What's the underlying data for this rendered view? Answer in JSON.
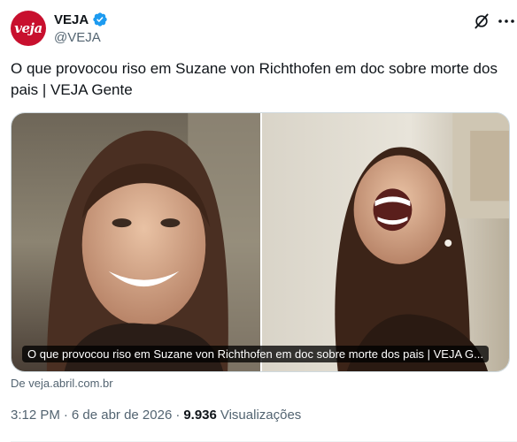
{
  "author": {
    "avatar_text": "veja",
    "display_name": "VEJA",
    "handle": "@VEJA",
    "verified": true,
    "brand_color": "#c8102e",
    "verified_color": "#1d9bf0"
  },
  "tweet": {
    "text": "O que provocou riso em Suzane von Richthofen em doc sobre morte dos pais | VEJA Gente"
  },
  "card": {
    "title": "O que provocou riso em Suzane von Richthofen em doc sobre morte dos pais | VEJA G...",
    "source": "De veja.abril.com.br"
  },
  "meta": {
    "time": "3:12 PM",
    "separator1": "·",
    "date": "6 de abr de 2026",
    "separator2": "·",
    "views_count": "9.936",
    "views_label": "Visualizações"
  },
  "icons": {
    "grok": "grok-icon",
    "more": "more-icon",
    "verified": "verified-badge-icon"
  }
}
